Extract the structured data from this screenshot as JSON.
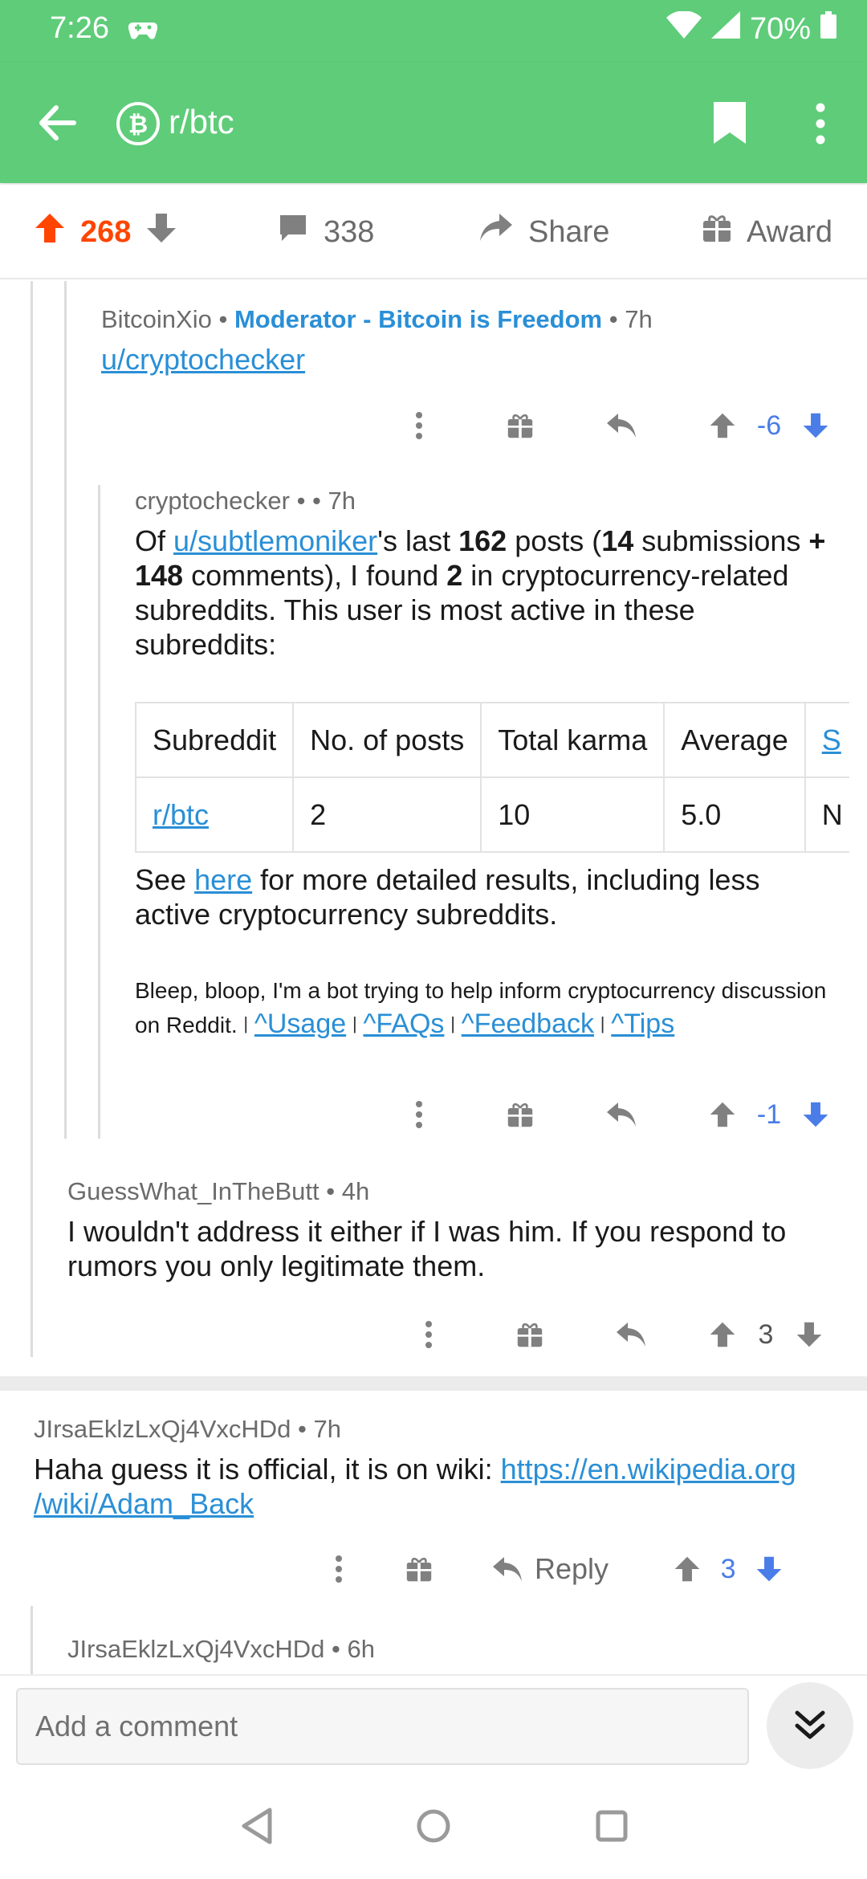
{
  "status": {
    "time": "7:26",
    "battery": "70%"
  },
  "header": {
    "subreddit": "r/btc"
  },
  "post_actions": {
    "score": "268",
    "comments": "338",
    "share": "Share",
    "award": "Award"
  },
  "comments": [
    {
      "author": "BitcoinXio",
      "flair": "Moderator - Bitcoin is Freedom",
      "age": "7h",
      "link": "u/cryptochecker",
      "score": "-6"
    },
    {
      "author": "cryptochecker",
      "age": "7h",
      "body": {
        "p1": "Of",
        "user_link": "u/subtlemoniker",
        "p2": "'s last",
        "posts": "162",
        "p3": "posts (",
        "submissions": "14",
        "p4": "submissions",
        "comments_count": "+ 148",
        "p5": "comments), I found",
        "found": "2",
        "p6": "in cryptocurrency-related subreddits. This user is most active in these subreddits:"
      },
      "table": {
        "headers": [
          "Subreddit",
          "No. of posts",
          "Total karma",
          "Average",
          "S"
        ],
        "rows": [
          [
            "r/btc",
            "2",
            "10",
            "5.0",
            "N"
          ]
        ]
      },
      "see": {
        "p1": "See",
        "link": "here",
        "p2": "for more detailed results, including less active cryptocurrency subreddits."
      },
      "footer": {
        "text1": "Bleep, bloop, I'm a bot trying to help inform cryptocurrency discussion",
        "text2": "on Reddit.",
        "links": [
          "^Usage",
          "^FAQs",
          "^Feedback",
          "^Tips"
        ]
      },
      "score": "-1"
    },
    {
      "author": "GuessWhat_InTheButt",
      "age": "4h",
      "body": "I wouldn't address it either if I was him. If you respond to rumors you only legitimate them.",
      "score": "3"
    },
    {
      "author": "JIrsaEklzLxQj4VxcHDd",
      "age": "7h",
      "body": "Haha guess it is official, it is on wiki:",
      "link1": "https://en.wikipedia.org",
      "link2": "/wiki/Adam_Back",
      "reply": "Reply",
      "score": "3"
    },
    {
      "author": "JIrsaEklzLxQj4VxcHDd",
      "age": "6h"
    }
  ],
  "composer": {
    "placeholder": "Add a comment"
  },
  "colors": {
    "header_green": "#5fcc79",
    "upvote_orange": "#ff4500",
    "downvote_blue": "#4a7de8",
    "link_blue": "#2a8fd6"
  }
}
